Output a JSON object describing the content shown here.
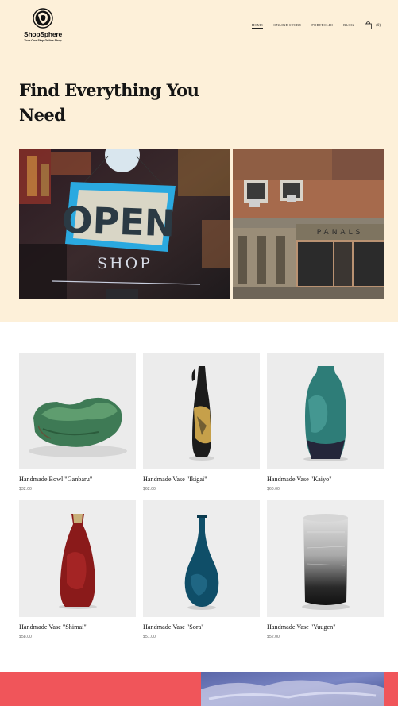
{
  "header": {
    "brand_name": "ShopSphere",
    "brand_tagline": "Your One-Stop Online Shop",
    "nav": [
      "HOME",
      "ONLINE STORE",
      "PORTFOLIO",
      "BLOG"
    ],
    "active_nav": "HOME",
    "cart_icon": "shopping-bag-icon",
    "cart_count": "(0)"
  },
  "hero": {
    "headline": "Find Everything You Need",
    "photo_sign_text": "OPEN",
    "photo_sign_subtext": "SHOP",
    "photo_building_sign": "PANALS"
  },
  "products": [
    {
      "name": "Handmade Bowl \"Ganbaru\"",
      "price": "$32.00",
      "color": "#3e7a55"
    },
    {
      "name": "Handmade Vase \"Ikigai\"",
      "price": "$62.00",
      "color": "#1b1b1b"
    },
    {
      "name": "Handmade Vase \"Kaiyo\"",
      "price": "$60.00",
      "color": "#2e7d78"
    },
    {
      "name": "Handmade Vase \"Shimai\"",
      "price": "$58.00",
      "color": "#8a1a1a"
    },
    {
      "name": "Handmade Vase \"Sora\"",
      "price": "$51.00",
      "color": "#0f4e68"
    },
    {
      "name": "Handmade Vase \"Yuugen\"",
      "price": "$52.00",
      "color": "#7a7a7a"
    }
  ],
  "colors": {
    "hero_background": "#fdf0d9",
    "band_accent": "#f0555a"
  }
}
